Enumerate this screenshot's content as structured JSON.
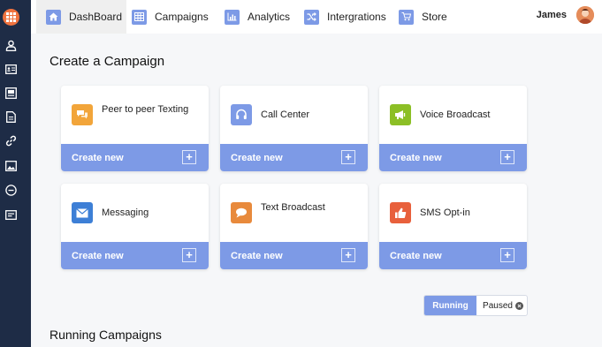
{
  "nav": {
    "tabs": [
      {
        "label": "DashBoard",
        "icon": "home-icon",
        "active": true
      },
      {
        "label": "Campaigns",
        "icon": "grid-icon",
        "active": false
      },
      {
        "label": "Analytics",
        "icon": "bar-chart-icon",
        "active": false
      },
      {
        "label": "Intergrations",
        "icon": "shuffle-icon",
        "active": false
      },
      {
        "label": "Store",
        "icon": "cart-icon",
        "active": false
      }
    ],
    "user_name": "James"
  },
  "sidebar": {
    "icons": [
      "user-icon",
      "contact-card-icon",
      "id-card-icon",
      "document-icon",
      "link-icon",
      "image-icon",
      "minus-circle-icon",
      "form-icon"
    ]
  },
  "page": {
    "title": "Create a Campaign",
    "running_section_title": "Running Campaigns"
  },
  "cards": [
    {
      "title": "Peer to peer Texting",
      "action": "Create new",
      "icon": "chat-icon",
      "color": "#f2a53a"
    },
    {
      "title": "Call Center",
      "action": "Create new",
      "icon": "headset-icon",
      "color": "#7d9ae6"
    },
    {
      "title": "Voice Broadcast",
      "action": "Create new",
      "icon": "megaphone-icon",
      "color": "#8cbf26"
    },
    {
      "title": "Messaging",
      "action": "Create new",
      "icon": "envelope-icon",
      "color": "#3d7fd6"
    },
    {
      "title": "Text Broadcast",
      "action": "Create new",
      "icon": "speech-bubble-icon",
      "color": "#e88a3c"
    },
    {
      "title": "SMS Opt-in",
      "action": "Create new",
      "icon": "thumbs-up-icon",
      "color": "#e8603c"
    }
  ],
  "toggle": {
    "running": "Running",
    "paused": "Paused"
  },
  "colors": {
    "accent": "#7d9ae6",
    "sidebar": "#1e2c46",
    "brand": "#f0733f"
  }
}
